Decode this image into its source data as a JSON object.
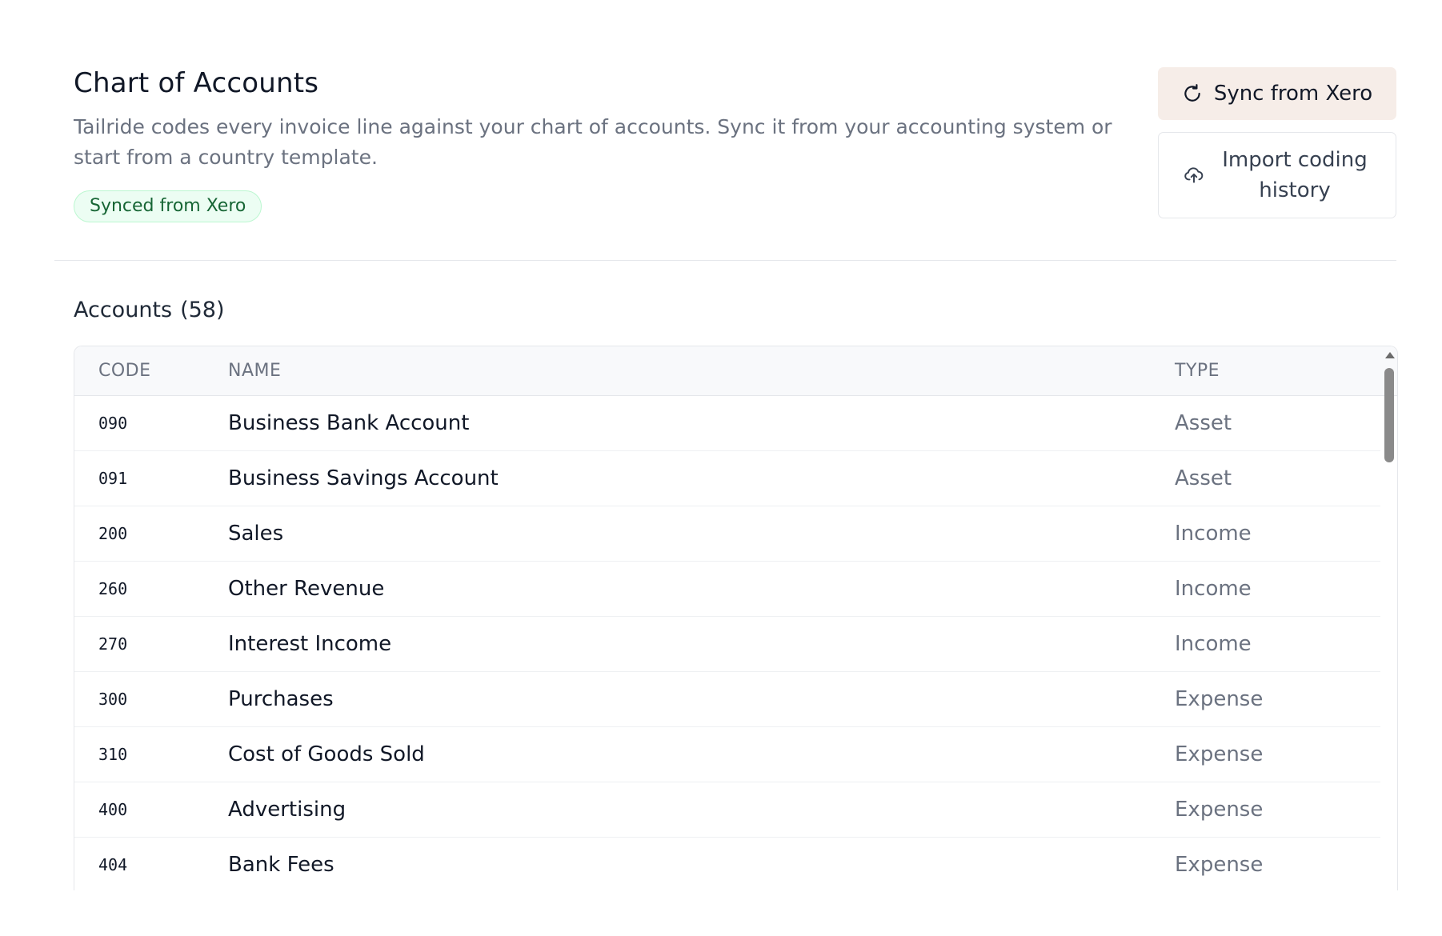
{
  "header": {
    "title": "Chart of Accounts",
    "description": "Tailride codes every invoice line against your chart of accounts. Sync it from your accounting system or start from a country template.",
    "badge": "Synced from Xero"
  },
  "actions": {
    "sync_label": "Sync from Xero",
    "sync_icon": "refresh-icon",
    "import_label": "Import coding history",
    "import_icon": "cloud-upload-icon"
  },
  "accounts": {
    "section_label": "Accounts",
    "count": "(58)",
    "columns": {
      "code": "CODE",
      "name": "NAME",
      "type": "TYPE"
    },
    "rows": [
      {
        "code": "090",
        "name": "Business Bank Account",
        "type": "Asset"
      },
      {
        "code": "091",
        "name": "Business Savings Account",
        "type": "Asset"
      },
      {
        "code": "200",
        "name": "Sales",
        "type": "Income"
      },
      {
        "code": "260",
        "name": "Other Revenue",
        "type": "Income"
      },
      {
        "code": "270",
        "name": "Interest Income",
        "type": "Income"
      },
      {
        "code": "300",
        "name": "Purchases",
        "type": "Expense"
      },
      {
        "code": "310",
        "name": "Cost of Goods Sold",
        "type": "Expense"
      },
      {
        "code": "400",
        "name": "Advertising",
        "type": "Expense"
      },
      {
        "code": "404",
        "name": "Bank Fees",
        "type": "Expense"
      }
    ]
  },
  "colors": {
    "accent_bg": "#f6ede8",
    "badge_green": "#166534",
    "muted_text": "#6b7280"
  }
}
